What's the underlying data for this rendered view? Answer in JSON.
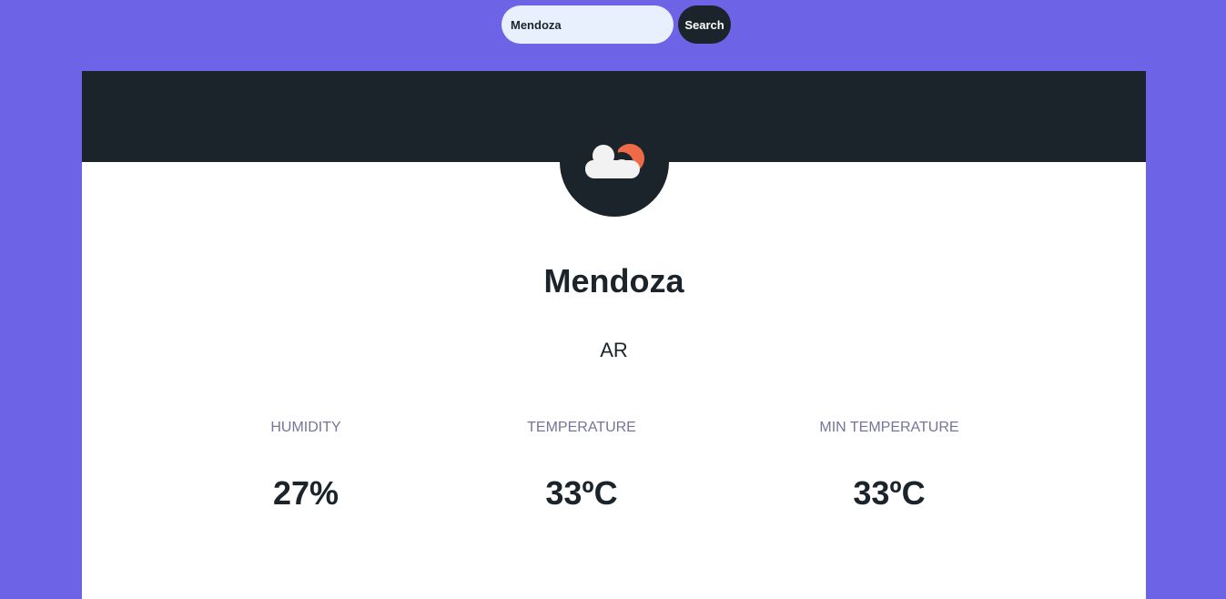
{
  "search": {
    "value": "Mendoza",
    "button_label": "Search"
  },
  "weather": {
    "icon": "partly-cloudy-icon",
    "city": "Mendoza",
    "country": "AR",
    "stats": [
      {
        "label": "HUMIDITY",
        "value": "27%"
      },
      {
        "label": "TEMPERATURE",
        "value": "33ºC"
      },
      {
        "label": "MIN TEMPERATURE",
        "value": "33ºC"
      }
    ]
  },
  "colors": {
    "background": "#6c63e6",
    "dark": "#1b232b",
    "sun": "#ef6a48",
    "cloud": "#f2f2f2",
    "label": "#75749a"
  }
}
